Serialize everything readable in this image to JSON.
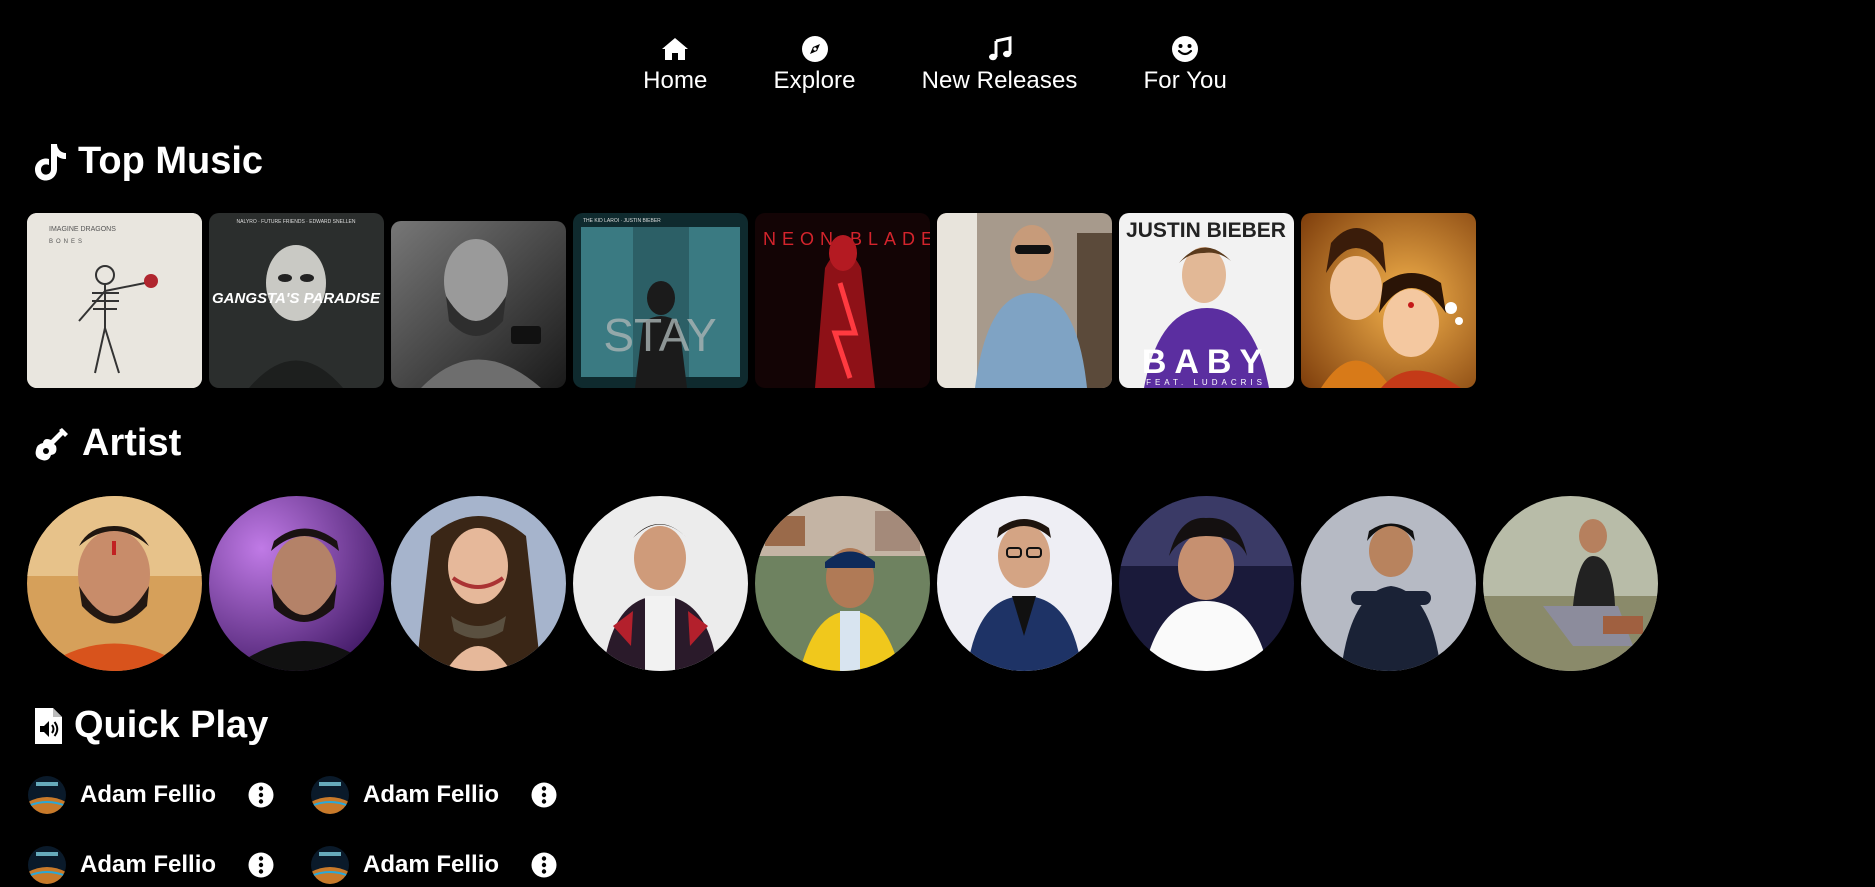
{
  "nav": {
    "items": [
      {
        "label": "Home",
        "icon": "home-icon"
      },
      {
        "label": "Explore",
        "icon": "compass-icon"
      },
      {
        "label": "New Releases",
        "icon": "music-note-icon"
      },
      {
        "label": "For You",
        "icon": "smile-icon"
      }
    ]
  },
  "sections": {
    "top_music": {
      "title": "Top Music",
      "icon": "tiktok-icon"
    },
    "artist": {
      "title": "Artist",
      "icon": "guitar-icon"
    },
    "quick_play": {
      "title": "Quick Play",
      "icon": "audio-file-icon"
    }
  },
  "albums": [
    {
      "cover_text_top": "IMAGINE DRAGONS",
      "cover_text_bottom": "BONES",
      "bg": "#e9e6df"
    },
    {
      "cover_text_top": "NALYRO · FUTURE FRIENDS · EDWARD SNELLEN",
      "cover_text_main": "GANGSTA'S PARADISE",
      "bg": "#2b2e2d"
    },
    {
      "bg": "#5a5a5a"
    },
    {
      "cover_text_top": "THE KID LAROI · JUSTIN BIEBER",
      "cover_text_main": "STAY",
      "bg": "#1d3a3e"
    },
    {
      "cover_text_top": "NEON BLADE",
      "bg": "#1a0607"
    },
    {
      "bg": "#8a7d70"
    },
    {
      "cover_text_top": "JUSTIN BIEBER",
      "cover_text_main": "BABY",
      "cover_text_bottom": "FEAT. LUDACRIS",
      "bg": "#4a2a7a"
    },
    {
      "bg": "#c4791f"
    }
  ],
  "artists": [
    {
      "bg": "#b4772a"
    },
    {
      "bg": "#7a3db8"
    },
    {
      "bg": "#9aa8c4"
    },
    {
      "bg": "#d8d8d8"
    },
    {
      "bg": "#6a7a6a"
    },
    {
      "bg": "#e4e4ec"
    },
    {
      "bg": "#202040"
    },
    {
      "bg": "#b8bcc4"
    },
    {
      "bg": "#a9b0a0"
    }
  ],
  "quick_play": {
    "items": [
      {
        "name": "Adam Fellio"
      },
      {
        "name": "Adam Fellio"
      },
      {
        "name": "Adam Fellio"
      },
      {
        "name": "Adam Fellio"
      }
    ]
  }
}
